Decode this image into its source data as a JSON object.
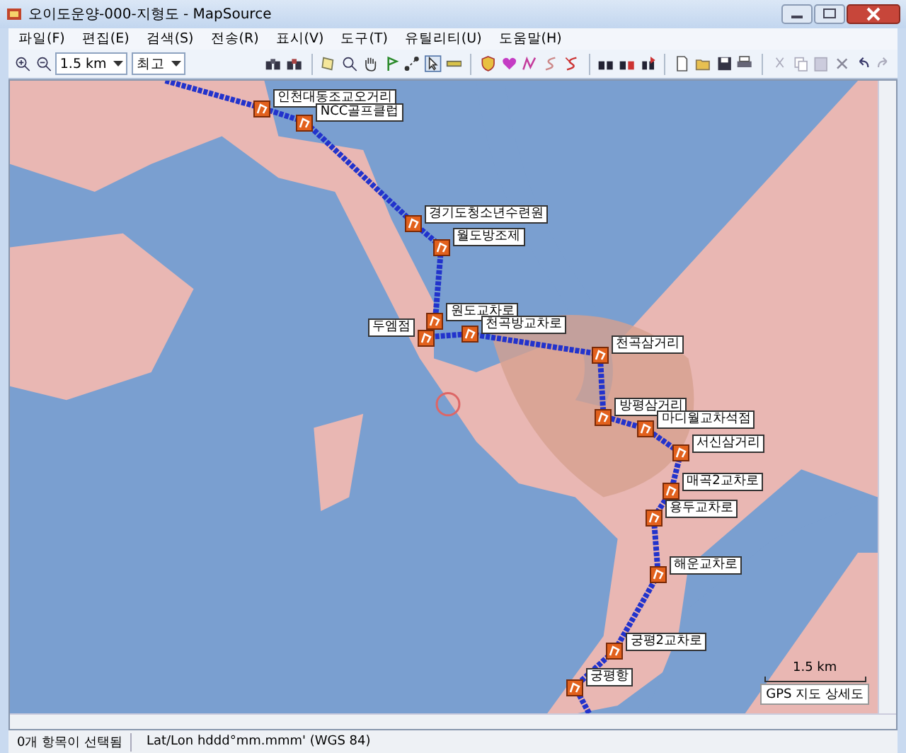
{
  "window": {
    "title": "오이도운양-000-지형도 - MapSource"
  },
  "menu": [
    "파일(F)",
    "편집(E)",
    "검색(S)",
    "전송(R)",
    "표시(V)",
    "도구(T)",
    "유틸리티(U)",
    "도움말(H)"
  ],
  "toolbar": {
    "zoom_scale": "1.5 km",
    "detail": "최고"
  },
  "waypoints": [
    "인천대동조교오거리",
    "NCC골프클럽",
    "경기도청소년수련원",
    "월도방조제",
    "원도교차로",
    "두엠점",
    "천곡방교차로",
    "천곡삼거리",
    "방평삼거리",
    "마디월교차석점",
    "서신삼거리",
    "매곡2교차로",
    "용두교차로",
    "해운교차로",
    "궁평2교차로",
    "궁평항"
  ],
  "scale_bar": {
    "distance": "1.5 km",
    "map_name": "GPS 지도 상세도"
  },
  "status_bar": {
    "selection": "0개 항목이 선택됨",
    "position_format": "Lat/Lon hddd°mm.mmm' (WGS 84)"
  }
}
